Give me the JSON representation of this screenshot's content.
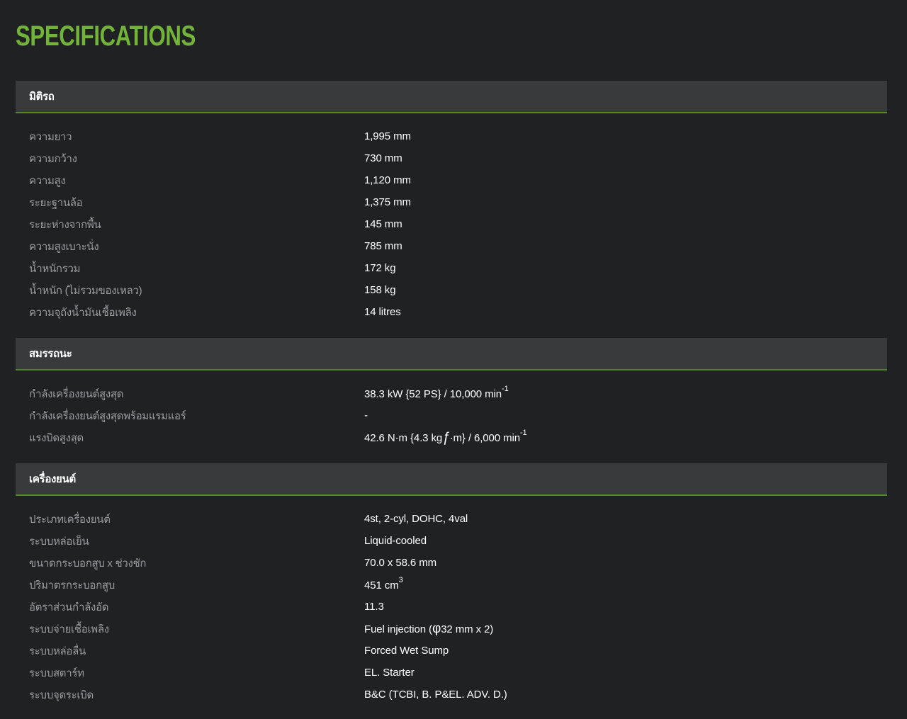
{
  "page": {
    "title": "SPECIFICATIONS"
  },
  "sections": [
    {
      "title": "มิติรถ",
      "rows": [
        {
          "label": "ความยาว",
          "value": "1,995 mm"
        },
        {
          "label": "ความกว้าง",
          "value": "730 mm"
        },
        {
          "label": "ความสูง",
          "value": "1,120 mm"
        },
        {
          "label": "ระยะฐานล้อ",
          "value": "1,375 mm"
        },
        {
          "label": "ระยะห่างจากพื้น",
          "value": "145 mm"
        },
        {
          "label": "ความสูงเบาะนั่ง",
          "value": "785 mm"
        },
        {
          "label": "น้ำหนักรวม",
          "value": "172 kg"
        },
        {
          "label": "น้ำหนัก (ไม่รวมของเหลว)",
          "value": "158 kg"
        },
        {
          "label": "ความจุถังน้ำมันเชื้อเพลิง",
          "value": "14 litres"
        }
      ]
    },
    {
      "title": "สมรรถนะ",
      "rows": [
        {
          "label": "กำลังเครื่องยนต์สูงสุด",
          "value": "38.3 kW {52 PS} / 10,000 min",
          "sup": "-1"
        },
        {
          "label": "กำลังเครื่องยนต์สูงสุดพร้อมแรมแอร์",
          "value": "-"
        },
        {
          "label": "แรงบิดสูงสุด",
          "value_a": "42.6 N·m {4.3 kg",
          "glyph": "ƒ",
          "value_b": "·m} / 6,000 min",
          "sup": "-1"
        }
      ]
    },
    {
      "title": "เครื่องยนต์",
      "rows": [
        {
          "label": "ประเภทเครื่องยนต์",
          "value": "4st, 2-cyl, DOHC, 4val"
        },
        {
          "label": "ระบบหล่อเย็น",
          "value": "Liquid-cooled"
        },
        {
          "label": "ขนาดกระบอกสูบ x ช่วงชัก",
          "value": "70.0 x 58.6 mm"
        },
        {
          "label": "ปริมาตรกระบอกสูบ",
          "value": "451 cm",
          "sup": "3"
        },
        {
          "label": "อัตราส่วนกำลังอัด",
          "value": "11.3"
        },
        {
          "label": "ระบบจ่ายเชื้อเพลิง",
          "value_a": "Fuel injection (",
          "glyph": "φ",
          "value_b": "32 mm x 2)"
        },
        {
          "label": "ระบบหล่อลื่น",
          "value": "Forced Wet Sump"
        },
        {
          "label": "ระบบสตาร์ท",
          "value": "EL. Starter"
        },
        {
          "label": "ระบบจุดระเบิด",
          "value": "B&C (TCBI, B. P&EL. ADV. D.)"
        }
      ]
    }
  ]
}
